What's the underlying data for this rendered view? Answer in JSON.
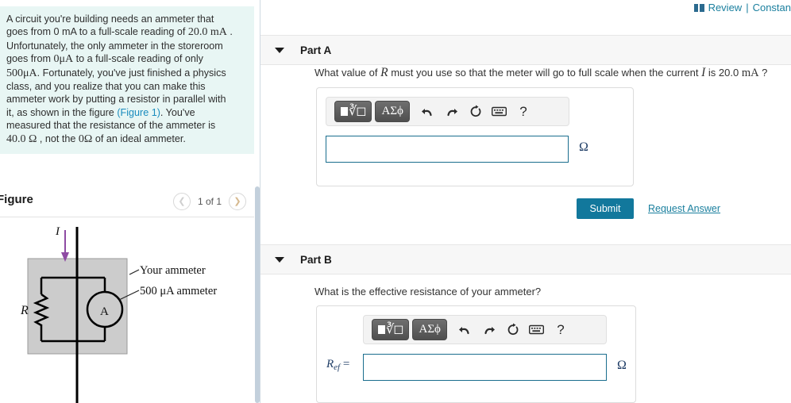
{
  "header": {
    "review_label": "Review",
    "separator": "|",
    "constants_label": "Constan",
    "book_icon": "book-icon"
  },
  "problem": {
    "line1": "A circuit you're building needs an ammeter that",
    "line2_a": "goes from 0 mA to a full-scale reading of ",
    "line2_b": "20.0 mA",
    "line2_c": " .",
    "line3": "Unfortunately, the only ammeter in the storeroom",
    "line4_a": "goes from ",
    "line4_b": "0μA",
    "line4_c": " to a full-scale reading of only",
    "line5_a": "500μA",
    "line5_b": ". Fortunately, you've just finished a physics",
    "line6": "class, and you realize that you can make this",
    "line7": "ammeter work by putting a resistor in parallel with",
    "line8_a": "it, as shown in the figure ",
    "line8_b": "(Figure 1)",
    "line8_c": ". You've",
    "line9": "measured that the resistance of the ammeter is",
    "line10_a": "40.0 Ω",
    "line10_b": " , not the ",
    "line10_c": "0Ω",
    "line10_d": " of an ideal ammeter.",
    "background_color": "#e8f6f4",
    "link_color": "#1a8cbe"
  },
  "figure": {
    "title": "Figure",
    "pager_label": "1 of 1",
    "prev_icon": "chevron-left-icon",
    "next_icon": "chevron-right-icon",
    "diagram": {
      "current_label": "I",
      "resistor_label": "R",
      "ammeter_label": "A",
      "callout_ammeter": "Your ammeter",
      "callout_meter": "500 μA ammeter",
      "arrow_color": "#8e4ba3",
      "box_fill": "#cccccc"
    }
  },
  "part_a": {
    "caret_icon": "caret-down-icon",
    "label": "Part A",
    "question_pre": "What value of ",
    "question_var1": "R",
    "question_mid": " must you use so that the meter will go to full scale when the current ",
    "question_var2": "I",
    "question_post": " is 20.0 ",
    "question_unit": "mA",
    "question_end": " ?",
    "toolbar": {
      "sqrt_button": "sqrt-button",
      "greek_button": "ΑΣϕ",
      "undo_icon": "undo-icon",
      "redo_icon": "redo-icon",
      "reset_icon": "reset-icon",
      "keyboard_icon": "keyboard-icon",
      "help_icon": "?"
    },
    "input_value": "",
    "input_placeholder": "",
    "unit": "Ω",
    "submit_label": "Submit",
    "request_answer_label": "Request Answer"
  },
  "part_b": {
    "caret_icon": "caret-down-icon",
    "label": "Part B",
    "question": "What is the effective resistance of your ammeter?",
    "toolbar": {
      "sqrt_button": "sqrt-button",
      "greek_button": "ΑΣϕ",
      "undo_icon": "undo-icon",
      "redo_icon": "redo-icon",
      "reset_icon": "reset-icon",
      "keyboard_icon": "keyboard-icon",
      "help_icon": "?"
    },
    "var_label_main": "R",
    "var_label_sub": "ef",
    "var_label_eq": "=",
    "input_value": "",
    "input_placeholder": "",
    "unit": "Ω"
  },
  "colors": {
    "accent": "#12789c",
    "link": "#1a7f9e",
    "input_border": "#1a6e8e",
    "panel_bg": "#f7f7f7"
  }
}
